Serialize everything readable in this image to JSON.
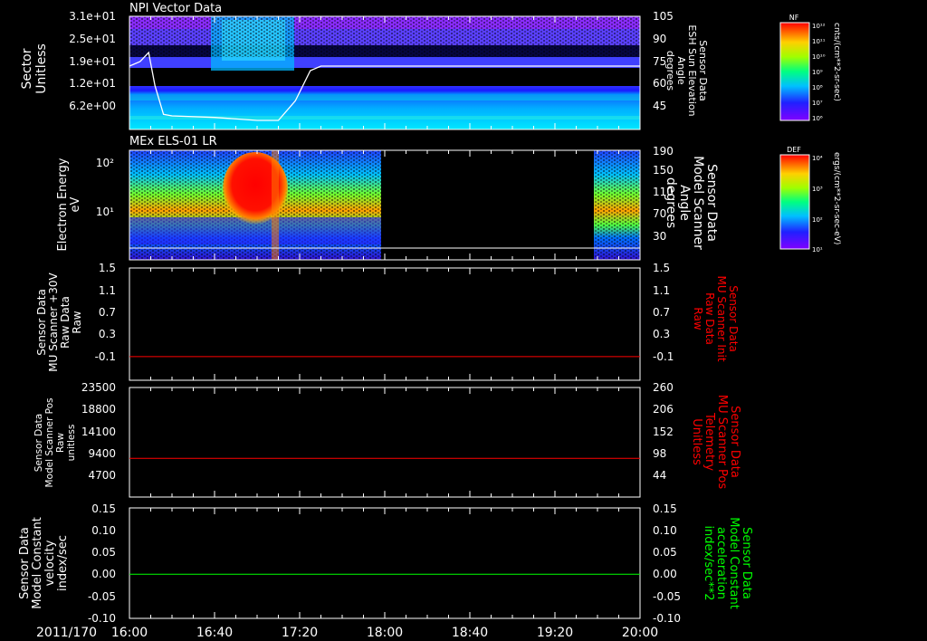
{
  "colors": {
    "background": "#000000",
    "axis": "#ffffff",
    "red": "#ff0000",
    "green": "#00ff00"
  },
  "date_label": "2011/170",
  "time_ticks": [
    "16:00",
    "16:40",
    "17:20",
    "18:00",
    "18:40",
    "19:20",
    "20:00"
  ],
  "colorbars": [
    {
      "tag": "NF",
      "units": "cnts/(cm**2-sr-sec)",
      "tick_labels": [
        "10¹²",
        "10¹¹",
        "10¹⁰",
        "10⁹",
        "10⁸",
        "10⁷",
        "10⁶"
      ]
    },
    {
      "tag": "DEF",
      "units": "ergs/(cm**2-sr-sec-eV)",
      "tick_labels": [
        "10⁴",
        "10³",
        "10²",
        "10¹"
      ]
    }
  ],
  "chart_data": [
    {
      "type": "heatmap",
      "title": "NPI Vector Data",
      "left_label": [
        "Sector",
        "Unitless"
      ],
      "left_ticks": [
        "3.1e+01",
        "2.5e+01",
        "1.9e+01",
        "1.2e+01",
        "6.2e+00"
      ],
      "right_label": [
        "Sensor Data",
        "ESH Sun Elevation",
        "Angle",
        "degrees"
      ],
      "right_ticks": [
        "105",
        "90",
        "75",
        "60",
        "45"
      ],
      "overlay_line": {
        "name": "ESH Sun Elevation Angle",
        "x": [
          "16:00",
          "16:05",
          "16:09",
          "16:12",
          "16:16",
          "16:20",
          "16:40",
          "17:00",
          "17:10",
          "17:18",
          "17:25",
          "17:30",
          "20:00"
        ],
        "y": [
          75,
          78,
          84,
          62,
          43,
          42,
          41,
          39,
          39,
          52,
          72,
          75,
          75
        ]
      }
    },
    {
      "type": "heatmap",
      "title": "MEx ELS-01 LR",
      "left_label": [
        "Electron Energy",
        "eV"
      ],
      "left_ticks": [
        "10²",
        "10¹"
      ],
      "right_label": [
        "Sensor Data",
        "Model Scanner",
        "Angle",
        "degrees"
      ],
      "right_ticks": [
        "190",
        "150",
        "110",
        "70",
        "30"
      ],
      "data_gap": [
        "17:57",
        "19:43"
      ]
    },
    {
      "type": "line",
      "left_label": [
        "Sensor Data",
        "MU Scanner +30V",
        "Raw Data",
        "Raw"
      ],
      "left_ticks": [
        "1.5",
        "1.1",
        "0.7",
        "0.3",
        "-0.1"
      ],
      "right_label": [
        "Sensor Data",
        "MU Scanner Init",
        "Raw Data",
        "Raw"
      ],
      "right_ticks": [
        "1.5",
        "1.1",
        "0.7",
        "0.3",
        "-0.1"
      ],
      "ylim": [
        -0.4,
        1.5
      ],
      "series": [
        {
          "x": [
            "16:00",
            "20:00"
          ],
          "values": [
            0.0,
            0.0
          ],
          "color": "#ff0000"
        }
      ]
    },
    {
      "type": "line",
      "left_label": [
        "Sensor Data",
        "Model Scanner Pos",
        "Raw",
        "unitless"
      ],
      "left_ticks": [
        "23500",
        "18800",
        "14100",
        "9400",
        "4700"
      ],
      "right_label": [
        "Sensor Data",
        "MU Scanner Pos",
        "Telemetry",
        "Unitless"
      ],
      "right_ticks": [
        "260",
        "206",
        "152",
        "98",
        "44"
      ],
      "ylim": [
        0,
        23500
      ],
      "series": [
        {
          "x": [
            "16:00",
            "20:00"
          ],
          "values": [
            8300,
            8300
          ],
          "color": "#ff0000"
        }
      ]
    },
    {
      "type": "line",
      "left_label": [
        "Sensor Data",
        "Model Constant",
        "velocity",
        "index/sec"
      ],
      "left_ticks": [
        "0.15",
        "0.10",
        "0.05",
        "0.00",
        "-0.05",
        "-0.10"
      ],
      "right_label": [
        "Sensor Data",
        "Model Constant",
        "acceleration",
        "index/sec**2"
      ],
      "right_ticks": [
        "0.15",
        "0.10",
        "0.05",
        "0.00",
        "-0.05",
        "-0.10"
      ],
      "ylim": [
        -0.1,
        0.15
      ],
      "series": [
        {
          "x": [
            "16:00",
            "20:00"
          ],
          "values": [
            0.0,
            0.0
          ],
          "color": "#00ff00"
        }
      ]
    }
  ]
}
